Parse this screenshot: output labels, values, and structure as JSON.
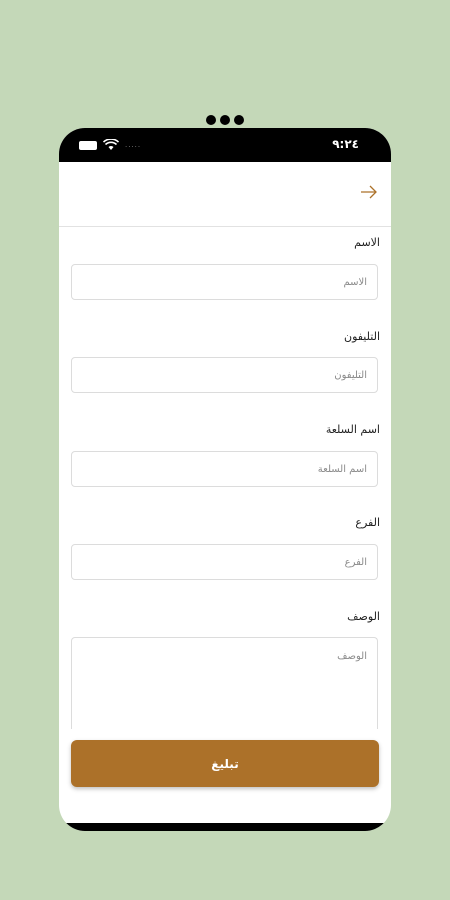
{
  "status_bar": {
    "time": "٩:٢٤"
  },
  "form": {
    "name": {
      "label": "الاسم",
      "placeholder": "الاسم"
    },
    "phone": {
      "label": "التليفون",
      "placeholder": "التليفون"
    },
    "item_name": {
      "label": "اسم السلعة",
      "placeholder": "اسم السلعة"
    },
    "branch": {
      "label": "الفرع",
      "placeholder": "الفرع"
    },
    "description": {
      "label": "الوصف",
      "placeholder": "الوصف"
    },
    "submit_label": "تبليغ"
  },
  "colors": {
    "accent": "#ac7129",
    "background": "#c4d8b8"
  },
  "icons": {
    "back": "arrow-right-icon"
  }
}
